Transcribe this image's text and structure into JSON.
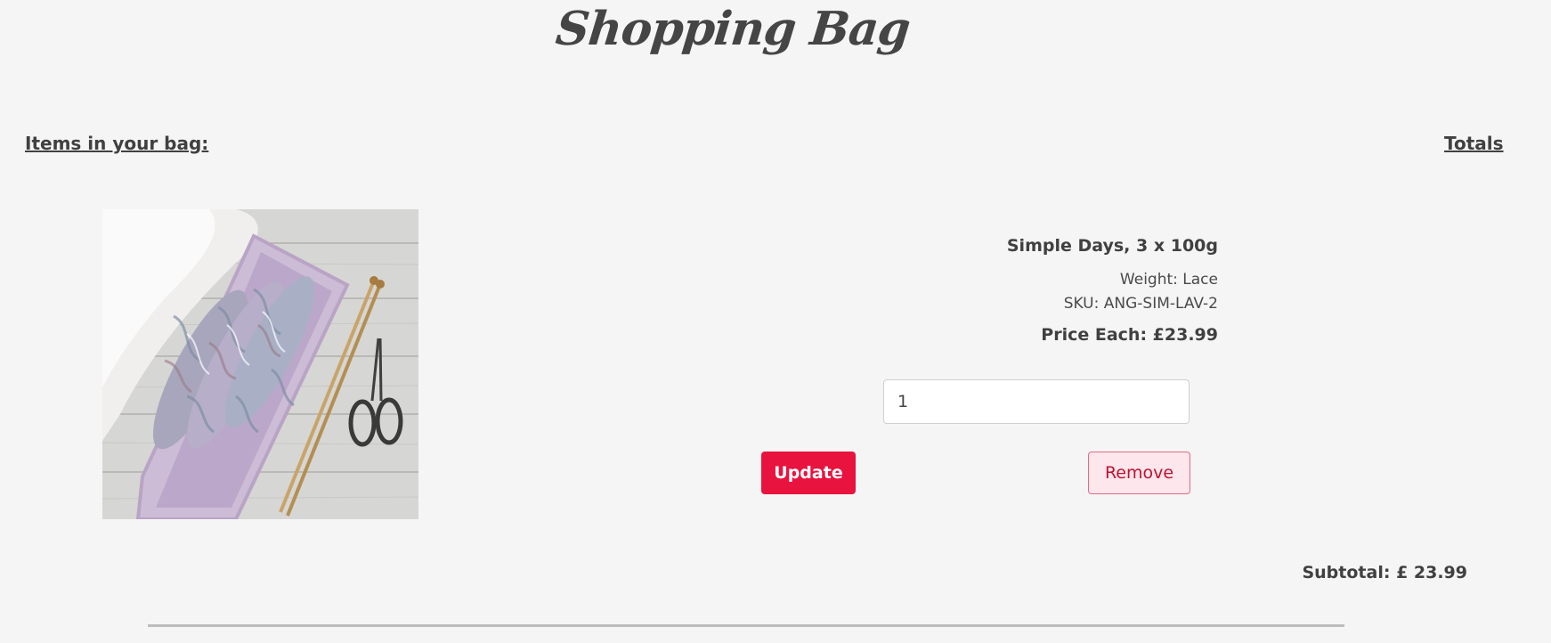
{
  "page": {
    "title": "Shopping Bag"
  },
  "bag": {
    "items_heading": "Items in your bag:",
    "totals_heading": "Totals"
  },
  "item": {
    "name": "Simple Days, 3 x 100g",
    "weight_label": "Weight:",
    "weight": "Lace",
    "sku_label": "SKU:",
    "sku": "ANG-SIM-LAV-2",
    "price_label": "Price Each:",
    "price": "£23.99",
    "quantity": "1",
    "image_icon": "yarn-skeins-photo"
  },
  "actions": {
    "update_label": "Update",
    "remove_label": "Remove"
  },
  "summary": {
    "subtotal_label": "Subtotal:",
    "subtotal_value": "£ 23.99"
  },
  "colors": {
    "accent": "#e8133f",
    "remove_bg": "#fde6ec",
    "background": "#f5f5f5"
  }
}
